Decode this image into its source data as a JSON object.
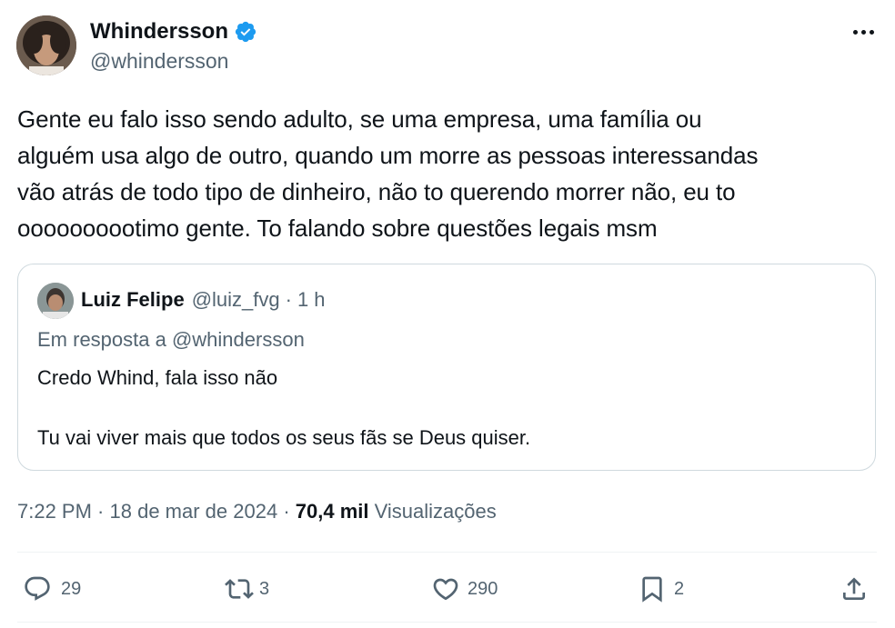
{
  "author": {
    "display_name": "Whindersson",
    "handle": "@whindersson",
    "verified": true
  },
  "tweet": {
    "text": "Gente eu falo isso sendo adulto, se uma empresa, uma família ou\nalguém usa algo de outro, quando um morre as pessoas interessandas\nvão atrás de todo tipo de dinheiro, não to querendo morrer não, eu to\noooooooootimo gente. To falando sobre questões legais msm"
  },
  "quote": {
    "display_name": "Luiz Felipe",
    "handle": "@luiz_fvg",
    "separator": "·",
    "time": "1 h",
    "reply_to": "Em resposta a @whindersson",
    "line1": "Credo Whind, fala isso não",
    "line2": "Tu vai viver mais que todos os seus fãs se Deus quiser."
  },
  "meta": {
    "time": "7:22 PM",
    "separator1": " · ",
    "date": "18 de mar de 2024",
    "separator2": " · ",
    "views_count": "70,4 mil",
    "views_label": " Visualizações"
  },
  "actions": {
    "replies": "29",
    "reposts": "3",
    "likes": "290",
    "bookmarks": "2"
  },
  "colors": {
    "verified": "#1d9bf0",
    "secondary_text": "#536471",
    "border": "#cfd9de"
  },
  "icons": [
    "verified-badge-icon",
    "more-icon",
    "reply-icon",
    "repost-icon",
    "like-icon",
    "bookmark-icon",
    "share-icon"
  ]
}
